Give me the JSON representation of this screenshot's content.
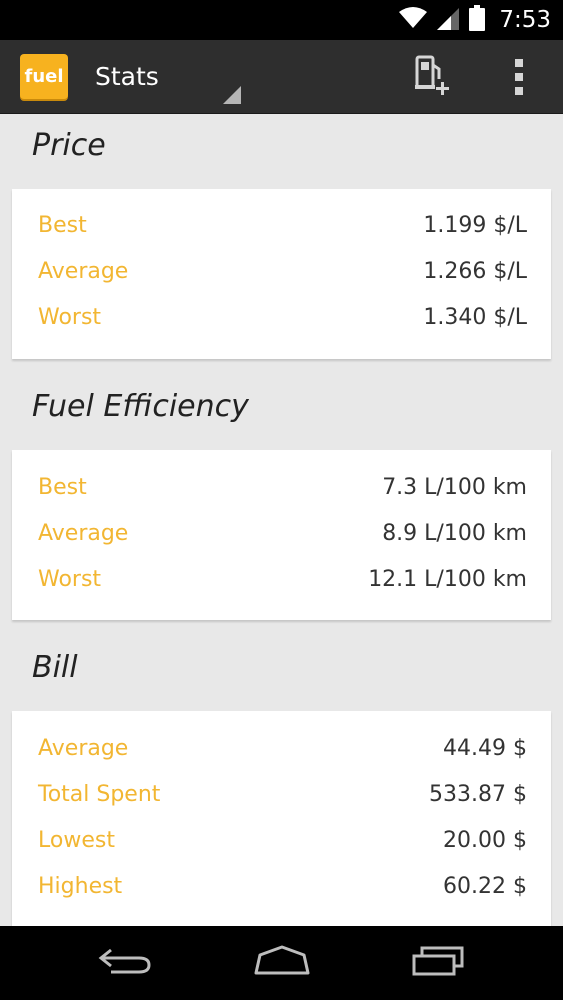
{
  "status_bar": {
    "time": "7:53"
  },
  "action_bar": {
    "logo_text": "fuel",
    "title": "Stats",
    "add_fuel_icon": "fuel-pump-add-icon",
    "overflow_icon": "overflow-menu-icon"
  },
  "sections": {
    "price": {
      "title": "Price",
      "rows": [
        {
          "label": "Best",
          "value": "1.199 $/L"
        },
        {
          "label": "Average",
          "value": "1.266 $/L"
        },
        {
          "label": "Worst",
          "value": "1.340 $/L"
        }
      ]
    },
    "efficiency": {
      "title": "Fuel Efficiency",
      "rows": [
        {
          "label": "Best",
          "value": "7.3 L/100 km"
        },
        {
          "label": "Average",
          "value": "8.9 L/100 km"
        },
        {
          "label": "Worst",
          "value": "12.1 L/100 km"
        }
      ]
    },
    "bill": {
      "title": "Bill",
      "rows": [
        {
          "label": "Average",
          "value": "44.49 $"
        },
        {
          "label": "Total Spent",
          "value": "533.87 $"
        },
        {
          "label": "Lowest",
          "value": "20.00 $"
        },
        {
          "label": "Highest",
          "value": "60.22 $"
        }
      ]
    }
  },
  "colors": {
    "accent": "#f2b632",
    "logo_bg": "#f7b21f",
    "action_bar_bg": "#2e2e2e",
    "page_bg": "#e8e8e8"
  },
  "nav_bar": {
    "back_icon": "back-icon",
    "home_icon": "home-icon",
    "recents_icon": "recents-icon"
  }
}
